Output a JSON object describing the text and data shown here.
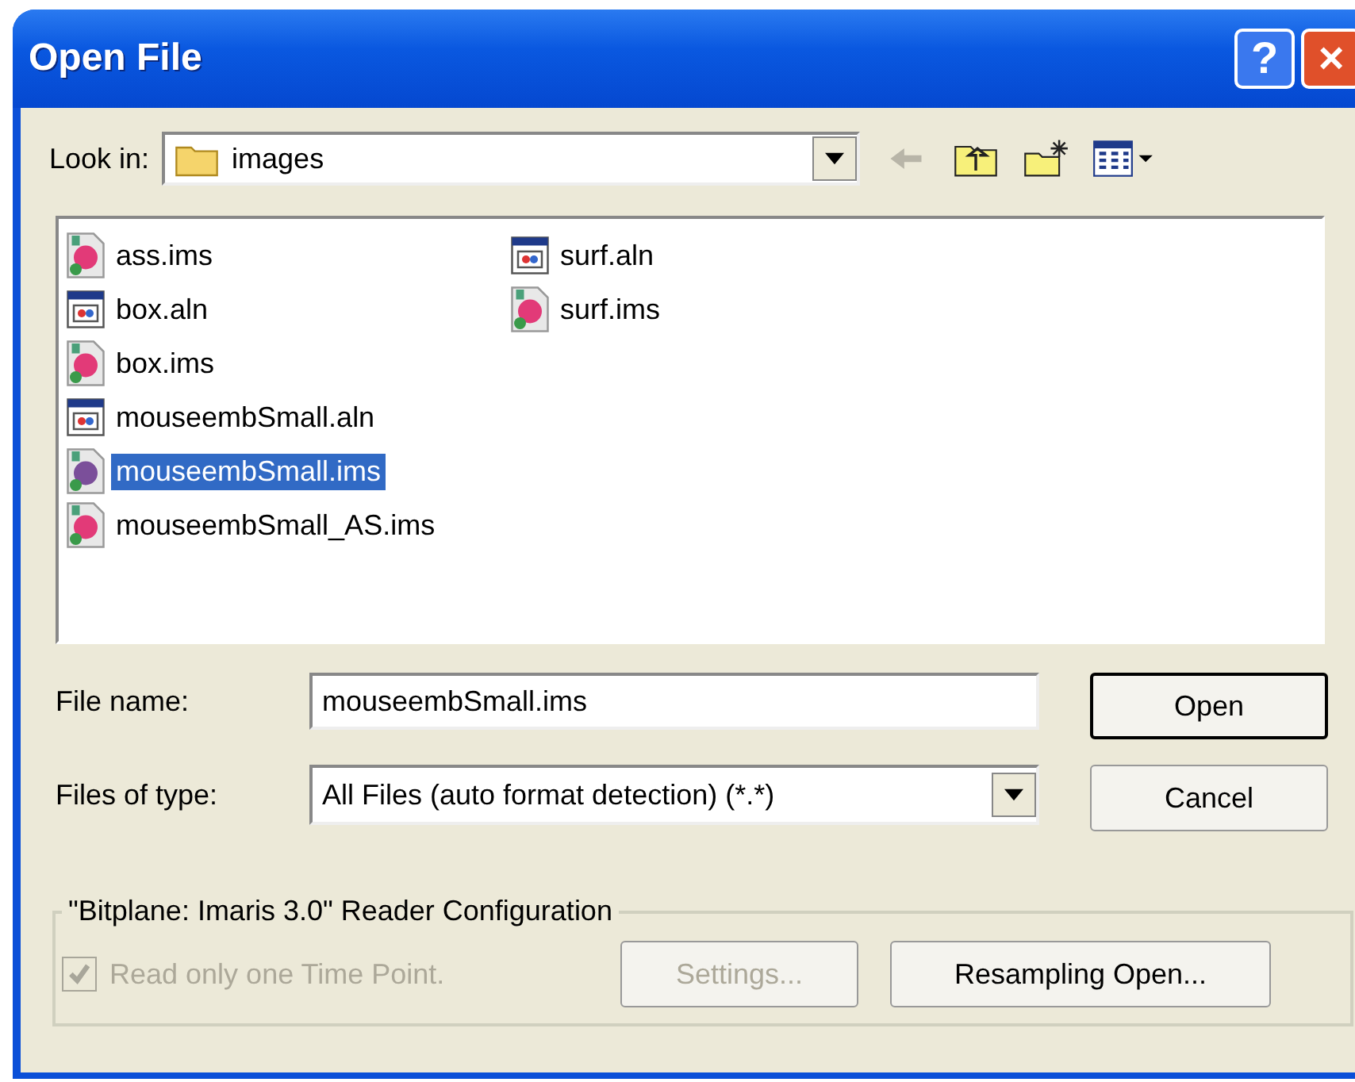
{
  "window": {
    "title": "Open File",
    "help_button": "?",
    "close_button": "×"
  },
  "look_in": {
    "label": "Look in:",
    "value": "images"
  },
  "files": [
    {
      "name": "ass.ims",
      "kind": "ims",
      "selected": false
    },
    {
      "name": "box.aln",
      "kind": "aln",
      "selected": false
    },
    {
      "name": "box.ims",
      "kind": "ims",
      "selected": false
    },
    {
      "name": "mouseembSmall.aln",
      "kind": "aln",
      "selected": false
    },
    {
      "name": "mouseembSmall.ims",
      "kind": "ims",
      "selected": true
    },
    {
      "name": "mouseembSmall_AS.ims",
      "kind": "ims",
      "selected": false
    },
    {
      "name": "surf.aln",
      "kind": "aln",
      "selected": false
    },
    {
      "name": "surf.ims",
      "kind": "ims",
      "selected": false
    }
  ],
  "file_name": {
    "label": "File name:",
    "value": "mouseembSmall.ims"
  },
  "file_type": {
    "label": "Files of type:",
    "value": "All Files (auto format detection) (*.*)"
  },
  "buttons": [
    {
      "label": "Open",
      "default": true
    },
    {
      "label": "Cancel",
      "default": false
    }
  ],
  "reader_config": {
    "title": "\"Bitplane: Imaris 3.0\" Reader Configuration",
    "checkbox": {
      "label": "Read only one Time Point.",
      "checked": true,
      "disabled": true
    },
    "buttons": [
      {
        "label": "Settings...",
        "disabled": true
      },
      {
        "label": "Resampling Open...",
        "disabled": false
      }
    ]
  }
}
